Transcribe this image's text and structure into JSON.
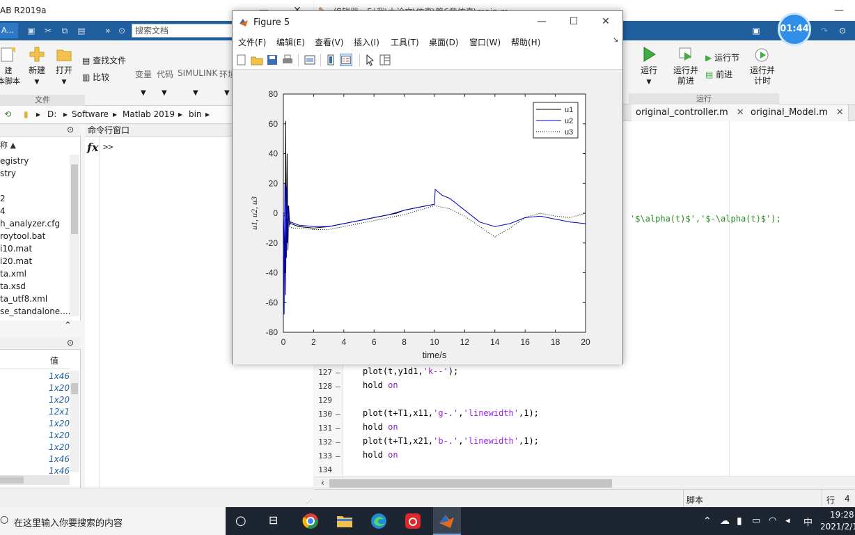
{
  "left_window": {
    "title": "AB R2019a",
    "min": "—",
    "max": "☐",
    "close": "✕",
    "qa_tab": "A...",
    "search_placeholder": "搜索文档",
    "ribbon": {
      "new_script": "建\n本脚本",
      "new": "新建",
      "open": "打开",
      "find_files": "查找文件",
      "compare": "比较",
      "section_file": "文件",
      "variable": "变量",
      "code": "代码",
      "simulink": "SIMULINK",
      "env": "环境"
    },
    "path": [
      "D:",
      "Software",
      "Matlab 2019",
      "bin"
    ],
    "file_panel": {
      "sort_label": "称 ▲",
      "files": [
        "egistry",
        "stry",
        "",
        "2",
        "4",
        "h_analyzer.cfg",
        "roytool.bat",
        "i10.mat",
        "i20.mat",
        "ta.xml",
        "ta.xsd",
        "ta_utf8.xml",
        "se_standalone...."
      ]
    },
    "workspace": {
      "col_value": "值",
      "values": [
        "1x46",
        "1x20",
        "1x20",
        "12x1",
        "1x20",
        "1x20",
        "1x20",
        "1x46",
        "1x46"
      ]
    },
    "command_window": {
      "title": "命令行窗口",
      "fx": "fx",
      "prompt": ">>"
    }
  },
  "editor": {
    "title": "编辑器 - F:\\我\\大论文\\仿真\\第6章仿真\\main.m",
    "ribbon": {
      "run": "运行",
      "run_advance": "运行并\n前进",
      "run_section": "运行节",
      "advance": "前进",
      "run_time": "运行并\n计时",
      "section_run": "运行"
    },
    "tabs": [
      {
        "label": "original_controller.m",
        "close": "✕"
      },
      {
        "label": "original_Model.m",
        "close": "✕"
      }
    ],
    "partial_line": "'$\\alpha(t)$','$-\\alpha(t)$');",
    "lines": [
      {
        "n": "127",
        "mark": "–",
        "code_a": "plot(t,y1d1,",
        "str": "'k--'",
        "code_b": ");"
      },
      {
        "n": "128",
        "mark": "–",
        "code_a": "hold ",
        "kw": "on"
      },
      {
        "n": "129",
        "mark": "",
        "code_a": ""
      },
      {
        "n": "130",
        "mark": "–",
        "code_a": "plot(t+T1,x11,",
        "str": "'g-.'",
        "code_m": ",",
        "str2": "'linewidth'",
        "code_b": ",1);"
      },
      {
        "n": "131",
        "mark": "–",
        "code_a": "hold ",
        "kw": "on"
      },
      {
        "n": "132",
        "mark": "–",
        "code_a": "plot(t+T1,x21,",
        "str": "'b-.'",
        "code_m": ",",
        "str2": "'linewidth'",
        "code_b": ",1);"
      },
      {
        "n": "133",
        "mark": "–",
        "code_a": "hold ",
        "kw": "on"
      },
      {
        "n": "134",
        "mark": "",
        "code_a": ""
      }
    ],
    "status_mode": "脚本",
    "status_row": "行",
    "status_row_num": "4"
  },
  "figure": {
    "title": "Figure 5",
    "min": "—",
    "max": "☐",
    "close": "✕",
    "menu": [
      "文件(F)",
      "编辑(E)",
      "查看(V)",
      "插入(I)",
      "工具(T)",
      "桌面(D)",
      "窗口(W)",
      "帮助(H)"
    ],
    "menu_arrow": "↘"
  },
  "chart_data": {
    "type": "line",
    "xlabel": "time/s",
    "ylabel": "u1, u2, u3",
    "xlim": [
      0,
      20
    ],
    "ylim": [
      -80,
      80
    ],
    "xticks": [
      0,
      2,
      4,
      6,
      8,
      10,
      12,
      14,
      16,
      18,
      20
    ],
    "yticks": [
      80,
      60,
      40,
      20,
      0,
      -20,
      -40,
      -60,
      -80
    ],
    "grid": false,
    "legend_position": "top-right",
    "series": [
      {
        "name": "u1",
        "color": "#000000",
        "style": "solid",
        "x": [
          0,
          0.1,
          0.15,
          0.2,
          0.25,
          0.3,
          0.35,
          0.4,
          0.5,
          1,
          2,
          3,
          4,
          5,
          6,
          7,
          7.5,
          8,
          9,
          10
        ],
        "y": [
          0,
          -40,
          62,
          -30,
          40,
          -25,
          5,
          -5,
          -7,
          -9,
          -10,
          -9,
          -7,
          -5,
          -3,
          -1,
          0,
          2,
          4,
          6
        ]
      },
      {
        "name": "u2",
        "color": "#0000c8",
        "style": "solid",
        "x": [
          0,
          0.05,
          0.1,
          0.15,
          0.2,
          0.25,
          0.3,
          0.4,
          0.5,
          1,
          2,
          3,
          4,
          5,
          6,
          7,
          8,
          9,
          10,
          10.05,
          10.5,
          11,
          12,
          13,
          14,
          15,
          16,
          17,
          18,
          19,
          20
        ],
        "y": [
          0,
          -68,
          20,
          -55,
          18,
          -20,
          5,
          -8,
          -6,
          -8,
          -9,
          -9,
          -7,
          -5,
          -3,
          -1,
          2,
          4,
          6,
          16,
          12,
          10,
          2,
          -6,
          -9,
          -7,
          -3,
          -2,
          -4,
          -6,
          -7
        ]
      },
      {
        "name": "u3",
        "color": "#000000",
        "style": "dotted",
        "x": [
          0,
          0.2,
          0.4,
          0.6,
          1,
          2,
          3,
          4,
          5,
          6,
          7,
          8,
          9,
          10,
          11,
          12,
          13,
          14,
          15,
          16,
          17,
          18,
          19,
          20
        ],
        "y": [
          0,
          -6,
          -9,
          -10,
          -10,
          -11,
          -11,
          -9,
          -7,
          -5,
          -3,
          -1,
          2,
          5,
          3,
          -2,
          -9,
          -16,
          -10,
          -3,
          0,
          -2,
          -3,
          0
        ]
      }
    ]
  },
  "timer": "01:44",
  "taskbar": {
    "search_placeholder": "在这里输入你要搜索的内容",
    "ime": "中",
    "time": "19:28",
    "date": "2021/2/1"
  }
}
